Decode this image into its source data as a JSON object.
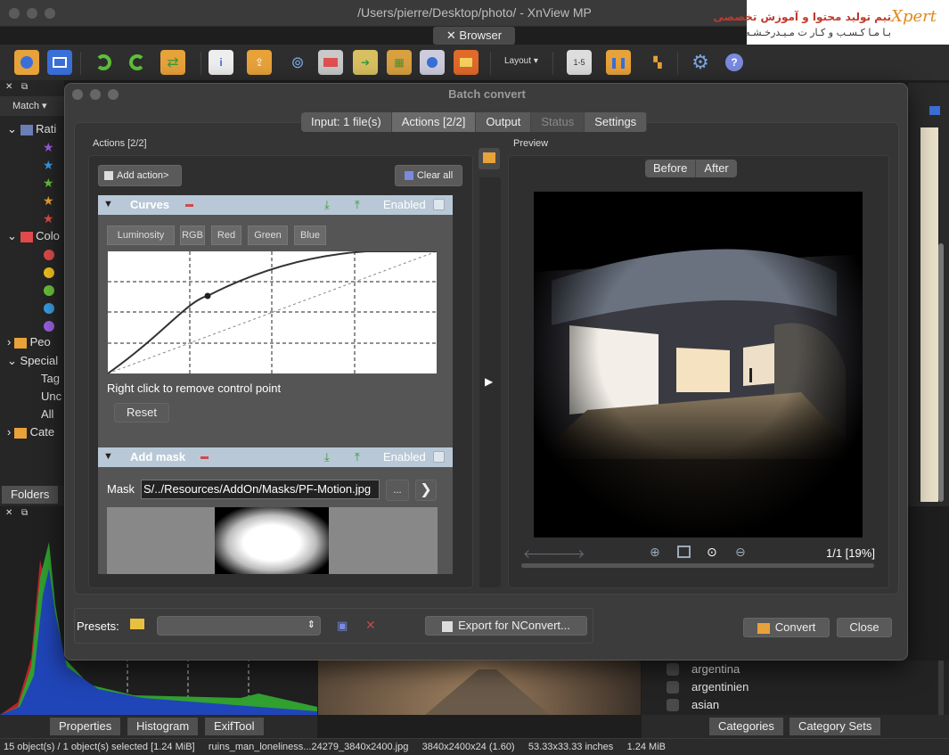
{
  "window": {
    "title": "/Users/pierre/Desktop/photo/ - XnView MP",
    "browser_tab": "Browser"
  },
  "logo": {
    "line1": "تیم تولید محتوا و آموزش تخصصی",
    "line2": "بـا مـا کـسـب و کـار ت مـیـدرخـشـه",
    "brand": "Xpert"
  },
  "toolbar": {
    "layout_label": "Layout"
  },
  "left_panel": {
    "match_label": "Match",
    "tree": {
      "ratings": "Rati",
      "colors": "Colo",
      "people": "Peo",
      "special": "Special",
      "tag": "Tag",
      "unc": "Unc",
      "all": "All",
      "categories": "Cate"
    },
    "folders_tab": "Folders"
  },
  "dialog": {
    "title": "Batch convert",
    "tabs": [
      "Input: 1 file(s)",
      "Actions [2/2]",
      "Output",
      "Status",
      "Settings"
    ],
    "actions_label": "Actions [2/2]",
    "add_action": "Add action>",
    "clear_all": "Clear all",
    "curves": {
      "name": "Curves",
      "enabled": "Enabled",
      "channels": [
        "Luminosity",
        "RGB",
        "Red",
        "Green",
        "Blue"
      ],
      "hint": "Right click to remove control point",
      "reset": "Reset"
    },
    "add_mask": {
      "name": "Add mask",
      "enabled": "Enabled",
      "mask_label": "Mask",
      "mask_path": "S/../Resources/AddOn/Masks/PF-Motion.jpg",
      "browse": "..."
    },
    "preview": {
      "label": "Preview",
      "before": "Before",
      "after": "After",
      "page_info": "1/1 [19%]"
    },
    "presets_label": "Presets:",
    "export_nconvert": "Export for NConvert...",
    "convert": "Convert",
    "close": "Close"
  },
  "categories_list": [
    "argentina",
    "argentinien",
    "asian"
  ],
  "bottom_tabs_left": [
    "Properties",
    "Histogram",
    "ExifTool"
  ],
  "bottom_tabs_right": [
    "Categories",
    "Category Sets"
  ],
  "status": {
    "selection": "15 object(s) / 1 object(s) selected [1.24 MiB]",
    "filename": "ruins_man_loneliness...24279_3840x2400.jpg",
    "dimensions": "3840x2400x24 (1.60)",
    "print_size": "53.33x33.33 inches",
    "size": "1.24 MiB"
  },
  "colors": {
    "accent": "#b8c8d6",
    "remove": "#d04a4a"
  }
}
